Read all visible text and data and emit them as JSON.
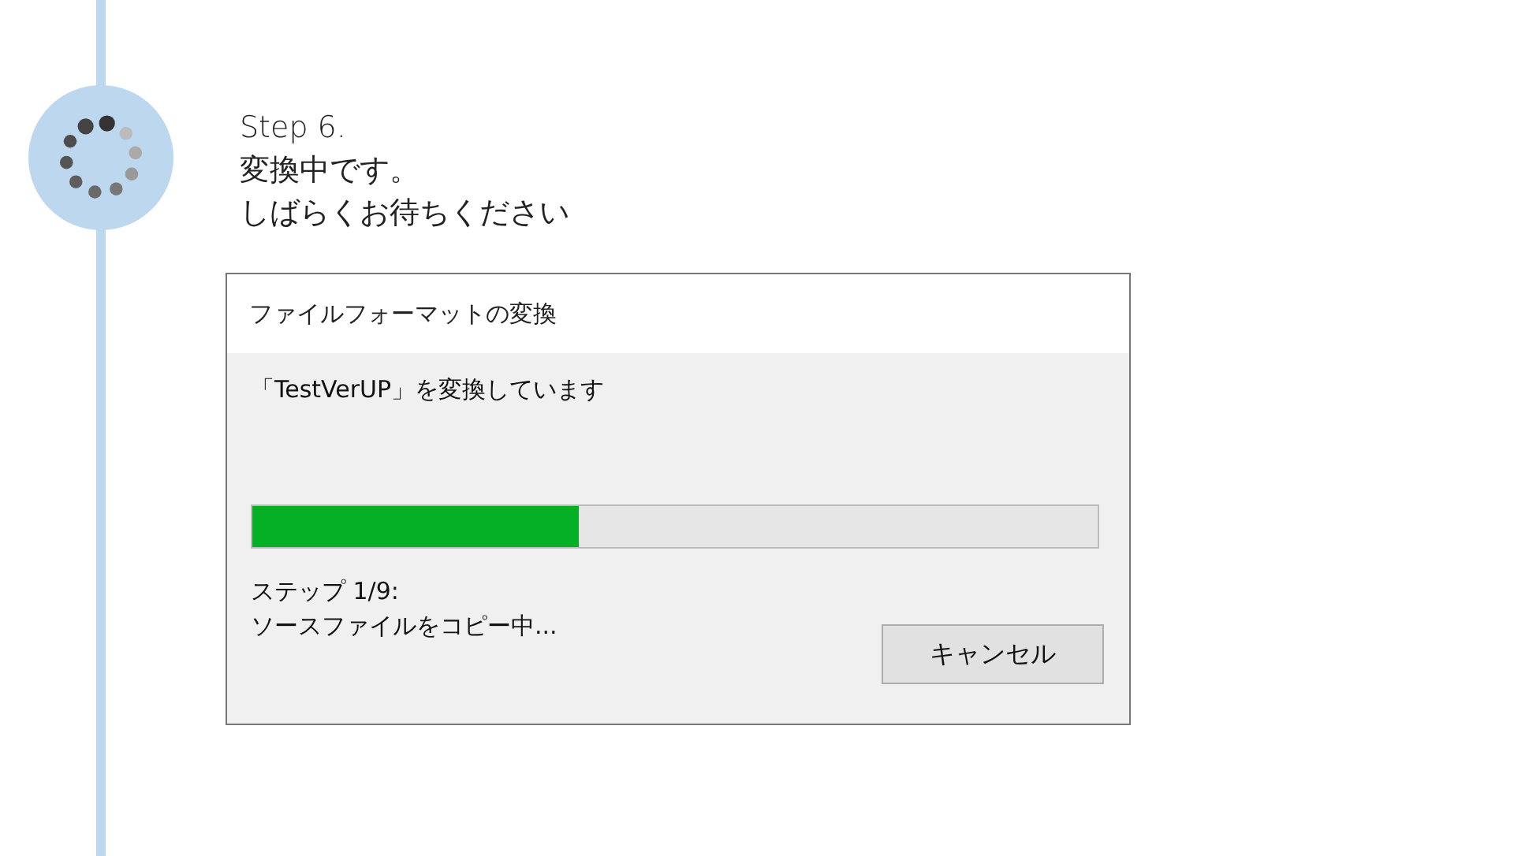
{
  "step": {
    "heading": "Step 6.",
    "lines": [
      "変換中です。",
      "しばらくお待ちください"
    ]
  },
  "dialog": {
    "title": "ファイルフォーマットの変換",
    "message": "「TestVerUP」を変換しています",
    "progress": {
      "level": 0.386
    },
    "status_lines": [
      "ステップ 1/9:",
      "ソースファイルをコピー中..."
    ],
    "cancel_button": "キャンセル"
  }
}
